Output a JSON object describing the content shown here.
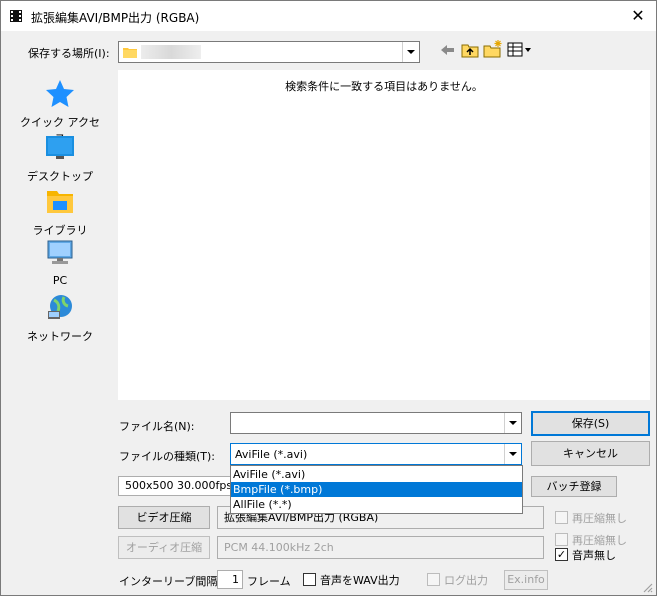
{
  "window": {
    "title": "拡張編集AVI/BMP出力 (RGBA)",
    "close_glyph": "✕"
  },
  "save_in": {
    "label": "保存する場所(I):",
    "value": ""
  },
  "file_list": {
    "empty_message": "検索条件に一致する項目はありません。"
  },
  "places": [
    {
      "label": "クイック アクセス",
      "icon": "star-icon"
    },
    {
      "label": "デスクトップ",
      "icon": "desktop-icon"
    },
    {
      "label": "ライブラリ",
      "icon": "folder-library-icon"
    },
    {
      "label": "PC",
      "icon": "computer-icon"
    },
    {
      "label": "ネットワーク",
      "icon": "network-globe-icon"
    }
  ],
  "filename": {
    "label": "ファイル名(N):",
    "value": ""
  },
  "filetype": {
    "label": "ファイルの種類(T):",
    "value": "AviFile (*.avi)",
    "options": [
      "AviFile (*.avi)",
      "BmpFile (*.bmp)",
      "AllFile (*.*)"
    ],
    "highlighted_index": 1
  },
  "buttons": {
    "save": "保存(S)",
    "cancel": "キャンセル",
    "batch": "バッチ登録",
    "video_compress": "ビデオ圧縮",
    "audio_compress": "オーディオ圧縮",
    "exinfo": "Ex.info"
  },
  "info": {
    "resolution": "500x500  30.000fps",
    "video_codec": "拡張編集AVI/BMP出力 (RGBA)",
    "audio_format": "PCM 44.100kHz 2ch"
  },
  "options": {
    "recompress_video": {
      "label": "再圧縮無し",
      "checked": false,
      "enabled": false
    },
    "recompress_audio": {
      "label": "再圧縮無し",
      "checked": false,
      "enabled": false
    },
    "no_audio": {
      "label": "音声無し",
      "checked": true,
      "enabled": true
    },
    "wav_output": {
      "label": "音声をWAV出力",
      "checked": false,
      "enabled": true
    },
    "log_output": {
      "label": "ログ出力",
      "checked": false,
      "enabled": false
    }
  },
  "interleave": {
    "label": "インターリーブ間隔 :",
    "value": "1",
    "unit": "フレーム"
  },
  "colors": {
    "accent": "#0078d7",
    "folder": "#ffc83d",
    "star": "#1e90ff"
  }
}
